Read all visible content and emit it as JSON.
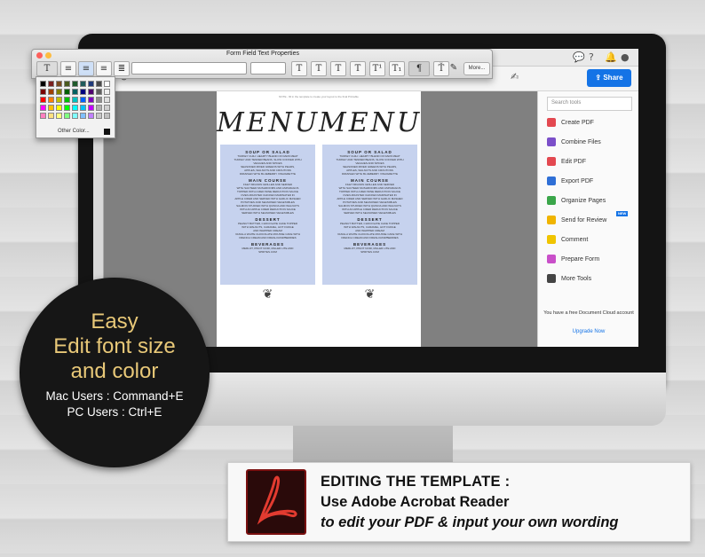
{
  "form_field_window": {
    "title": "Form Field Text Properties",
    "more_label": "More...",
    "color_palette": {
      "other_color_label": "Other Color...",
      "selected_color": "#111111",
      "swatches": [
        "#000000",
        "#7a1f1f",
        "#7a4a1f",
        "#4a5a1f",
        "#1f5a2a",
        "#1f5a5a",
        "#1f3a7a",
        "#4a4a4a",
        "#ffffff",
        "#7a0000",
        "#a04000",
        "#808000",
        "#006000",
        "#006060",
        "#000080",
        "#500070",
        "#606060",
        "#f0f0f0",
        "#ff0000",
        "#ff8000",
        "#c0c000",
        "#00c000",
        "#00c0c0",
        "#0060ff",
        "#8000c0",
        "#909090",
        "#e0e0e0",
        "#ff00ff",
        "#ffc000",
        "#ffff00",
        "#00ff00",
        "#00ffff",
        "#00c0ff",
        "#c000ff",
        "#b0b0b0",
        "#d0d0d0",
        "#ff80c0",
        "#ffe080",
        "#ffff80",
        "#80ff80",
        "#80ffff",
        "#80c0ff",
        "#c080ff",
        "#c8c8c8",
        "#c0c0c0"
      ]
    },
    "toolbar_glyphs": [
      "T",
      "T",
      "T",
      "T",
      "T¹",
      "T₁",
      "¶"
    ]
  },
  "acrobat": {
    "share_label": "Share",
    "page_note": "NOTE - fill in the template to create your layout to the final Printable",
    "menu": {
      "title": "MENU",
      "sections": [
        {
          "head": "SOUP OR SALAD",
          "lines": [
            "TURKEY CHILI: HEARTY BLEND OF DARK MEAT",
            "TURKEY AND TENDER BEANS, SLOW COOKED WITH",
            "VEGGIES AND SPICES",
            "",
            "SEASONED MIXED GREENS WITH PEARS,",
            "APPLES, WALNUTS AND CROUTONS",
            "DRIZZLED WITH BLUEBERRY VINAIGRETTE"
          ]
        },
        {
          "head": "MAIN COURSE",
          "lines": [
            "FILET MIGNON GRILLED AND SERVED",
            "WITH SAUTEED MUSHROOMS AND ASPARAGUS",
            "TOPPED WITH A RED WINE REDUCTION SAUCE",
            "",
            "OVEN-ROASTED CHICKEN MARINATED IN",
            "APPLE CIDER AND SERVED WITH GARLIC MASHED",
            "POTATOES AND SEASONED VEGETABLES",
            "",
            "SALMON STUFFED WITH QUINOA AND WALNUTS",
            "WITH AN APPLE CIDER REDUCTION SAUCE",
            "SERVED WITH SEASONED VEGETABLES"
          ]
        },
        {
          "head": "DESSERT",
          "lines": [
            "PEANUT BUTTER, CHOCOLATE CAKE TOPPED",
            "WITH WALNUTS, CARAMEL, HOT FUDGE",
            "AND WHIPPED CREAM",
            "",
            "VANILLA WHITE CHOCOLATE MOUSSE CAKE WITH",
            "FRENCH CREAM AND FRESH RASPBERRIES"
          ]
        },
        {
          "head": "BEVERAGES",
          "lines": [
            "MERLOT, PINOT NOIR, MILLER LITE AND",
            "SPRITES.COM"
          ]
        }
      ]
    },
    "right_panel": {
      "search_placeholder": "Search tools",
      "tools": [
        {
          "label": "Create PDF",
          "icon": "create-pdf-icon",
          "color": "#e34850"
        },
        {
          "label": "Combine Files",
          "icon": "combine-files-icon",
          "color": "#7b4fc9"
        },
        {
          "label": "Edit PDF",
          "icon": "edit-pdf-icon",
          "color": "#e34850"
        },
        {
          "label": "Export PDF",
          "icon": "export-pdf-icon",
          "color": "#2f6fd6"
        },
        {
          "label": "Organize Pages",
          "icon": "organize-pages-icon",
          "color": "#3aa64a"
        },
        {
          "label": "Send for Review",
          "icon": "send-for-review-icon",
          "color": "#f0b400",
          "badge": "NEW"
        },
        {
          "label": "Comment",
          "icon": "comment-icon",
          "color": "#f0c400"
        },
        {
          "label": "Prepare Form",
          "icon": "prepare-form-icon",
          "color": "#c94fc9"
        },
        {
          "label": "More Tools",
          "icon": "more-tools-icon",
          "color": "#444444"
        }
      ],
      "cloud_note": "You have a free Document Cloud account",
      "upgrade_label": "Upgrade Now"
    }
  },
  "badge": {
    "line1": "Easy",
    "line2": "Edit font size",
    "line3": "and color",
    "mac": "Mac Users : Command+E",
    "pc": "PC Users : Ctrl+E"
  },
  "caption": {
    "line1": "EDITING THE TEMPLATE :",
    "line2": "Use Adobe Acrobat Reader",
    "line3": "to edit your PDF & input your own wording"
  },
  "colors": {
    "badge_text": "#e8c878",
    "accent_blue": "#1473e6",
    "menu_highlight": "#c6d2ee"
  }
}
